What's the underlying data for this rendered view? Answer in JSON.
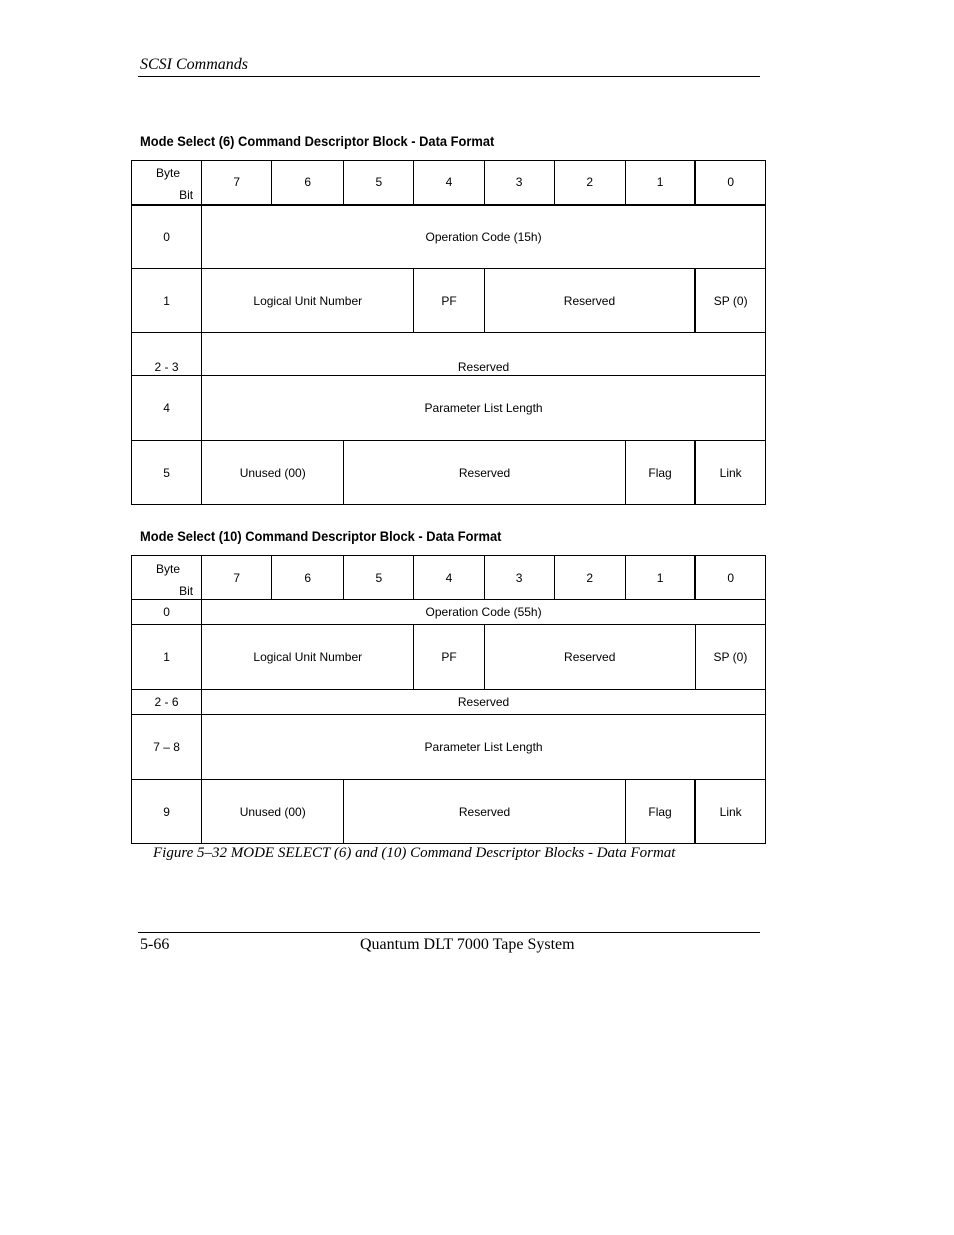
{
  "header": {
    "section": "SCSI Commands"
  },
  "tables": [
    {
      "title": "Mode Select (6) Command Descriptor Block - Data Format",
      "bit_label": "Bit",
      "byte_label": "Byte",
      "bits": [
        "7",
        "6",
        "5",
        "4",
        "3",
        "2",
        "1",
        "0"
      ],
      "rows": [
        {
          "byte": "0",
          "fields": [
            "Operation Code (15h)"
          ]
        },
        {
          "byte": "1",
          "fields": [
            "Logical Unit Number",
            "PF",
            "Reserved",
            "SP (0)"
          ]
        },
        {
          "byte": "2 - 3",
          "fields": [
            "Reserved"
          ]
        },
        {
          "byte": "4",
          "fields": [
            "Parameter List Length"
          ]
        },
        {
          "byte": "5",
          "fields": [
            "Unused (00)",
            "Reserved",
            "Flag",
            "Link"
          ]
        }
      ]
    },
    {
      "title": "Mode Select (10) Command Descriptor Block - Data Format",
      "bit_label": "Bit",
      "byte_label": "Byte",
      "bits": [
        "7",
        "6",
        "5",
        "4",
        "3",
        "2",
        "1",
        "0"
      ],
      "rows": [
        {
          "byte": "0",
          "fields": [
            "Operation Code (55h)"
          ]
        },
        {
          "byte": "1",
          "fields": [
            "Logical Unit Number",
            "PF",
            "Reserved",
            "SP (0)"
          ]
        },
        {
          "byte": "2 - 6",
          "fields": [
            "Reserved"
          ]
        },
        {
          "byte": "7 – 8",
          "fields": [
            "Parameter List Length"
          ]
        },
        {
          "byte": "9",
          "fields": [
            "Unused (00)",
            "Reserved",
            "Flag",
            "Link"
          ]
        }
      ]
    }
  ],
  "caption": "Figure 5–32  MODE SELECT (6) and (10) Command Descriptor Blocks - Data Format",
  "footer": {
    "page": "5-66",
    "title": "Quantum DLT 7000 Tape System"
  }
}
